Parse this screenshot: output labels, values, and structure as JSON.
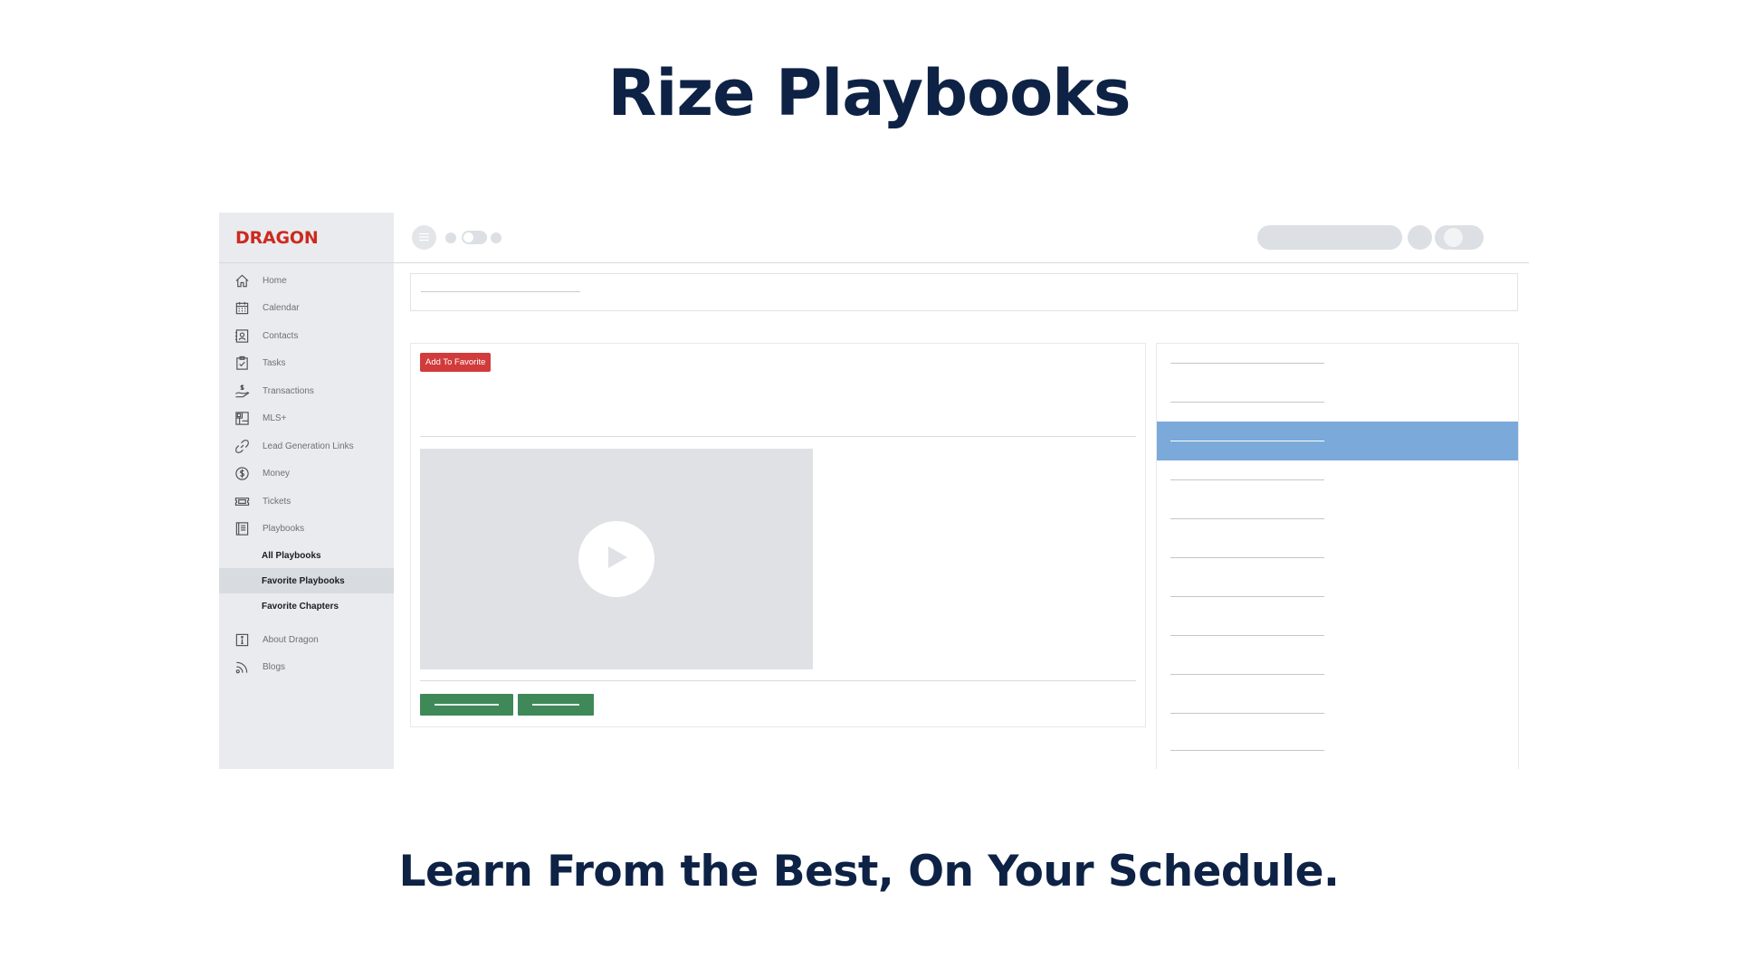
{
  "hero": {
    "title": "Rize Playbooks",
    "subtitle": "Learn From the Best, On Your Schedule."
  },
  "brand": "DRAGON",
  "sidebar": {
    "items": [
      {
        "label": "Home",
        "icon": "home-icon"
      },
      {
        "label": "Calendar",
        "icon": "calendar-icon"
      },
      {
        "label": "Contacts",
        "icon": "contacts-icon"
      },
      {
        "label": "Tasks",
        "icon": "tasks-icon"
      },
      {
        "label": "Transactions",
        "icon": "transactions-icon"
      },
      {
        "label": "MLS+",
        "icon": "mls-icon"
      },
      {
        "label": "Lead Generation Links",
        "icon": "link-icon"
      },
      {
        "label": "Money",
        "icon": "dollar-icon"
      },
      {
        "label": "Tickets",
        "icon": "ticket-icon"
      },
      {
        "label": "Playbooks",
        "icon": "book-icon"
      }
    ],
    "sub_items": [
      {
        "label": "All Playbooks",
        "active": false
      },
      {
        "label": "Favorite Playbooks",
        "active": true
      },
      {
        "label": "Favorite Chapters",
        "active": false
      }
    ],
    "footer_items": [
      {
        "label": "About Dragon",
        "icon": "info-icon"
      },
      {
        "label": "Blogs",
        "icon": "rss-icon"
      }
    ]
  },
  "main": {
    "favorite_button": "Add To Favorite",
    "video_icon": "play-icon"
  },
  "chapters": {
    "count": 11,
    "active_index": 2
  },
  "colors": {
    "brand": "#cc2a1f",
    "heading": "#0d2245",
    "favorite_button": "#d23b3b",
    "action_button": "#3f8858",
    "active_chapter": "#7aa9da",
    "sidebar_bg": "#e9ebee"
  }
}
